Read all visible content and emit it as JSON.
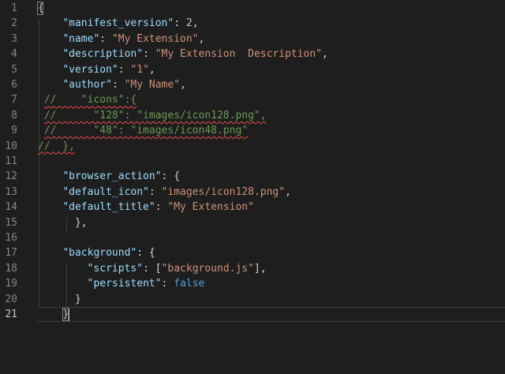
{
  "lines": [
    {
      "n": "1",
      "tokens": [
        {
          "t": "{",
          "c": "punct"
        }
      ]
    },
    {
      "n": "2",
      "tokens": [
        {
          "t": "    ",
          "c": "punct"
        },
        {
          "t": "\"manifest_version\"",
          "c": "key"
        },
        {
          "t": ": ",
          "c": "punct"
        },
        {
          "t": "2",
          "c": "num"
        },
        {
          "t": ",",
          "c": "punct"
        }
      ]
    },
    {
      "n": "3",
      "tokens": [
        {
          "t": "    ",
          "c": "punct"
        },
        {
          "t": "\"name\"",
          "c": "key"
        },
        {
          "t": ": ",
          "c": "punct"
        },
        {
          "t": "\"My Extension\"",
          "c": "str"
        },
        {
          "t": ",",
          "c": "punct"
        }
      ]
    },
    {
      "n": "4",
      "tokens": [
        {
          "t": "    ",
          "c": "punct"
        },
        {
          "t": "\"description\"",
          "c": "key"
        },
        {
          "t": ": ",
          "c": "punct"
        },
        {
          "t": "\"My Extension  Description\"",
          "c": "str"
        },
        {
          "t": ",",
          "c": "punct"
        }
      ]
    },
    {
      "n": "5",
      "tokens": [
        {
          "t": "    ",
          "c": "punct"
        },
        {
          "t": "\"version\"",
          "c": "key"
        },
        {
          "t": ": ",
          "c": "punct"
        },
        {
          "t": "\"1\"",
          "c": "str"
        },
        {
          "t": ",",
          "c": "punct"
        }
      ]
    },
    {
      "n": "6",
      "tokens": [
        {
          "t": "    ",
          "c": "punct"
        },
        {
          "t": "\"author\"",
          "c": "key"
        },
        {
          "t": ": ",
          "c": "punct"
        },
        {
          "t": "\"My Name\"",
          "c": "str"
        },
        {
          "t": ",",
          "c": "punct"
        }
      ]
    },
    {
      "n": "7",
      "tokens": [
        {
          "t": " ",
          "c": "punct"
        },
        {
          "t": "//    \"icons\":{",
          "c": "cmt squig"
        }
      ]
    },
    {
      "n": "8",
      "tokens": [
        {
          "t": " ",
          "c": "punct"
        },
        {
          "t": "//      \"128\": \"images/icon128.png\",",
          "c": "cmt squig"
        }
      ]
    },
    {
      "n": "9",
      "tokens": [
        {
          "t": " ",
          "c": "punct"
        },
        {
          "t": "//      \"48\": \"images/icon48.png\"",
          "c": "cmt squig"
        }
      ]
    },
    {
      "n": "10",
      "tokens": [
        {
          "t": "//  },",
          "c": "cmt squig"
        }
      ]
    },
    {
      "n": "11",
      "tokens": []
    },
    {
      "n": "12",
      "tokens": [
        {
          "t": "    ",
          "c": "punct"
        },
        {
          "t": "\"browser_action\"",
          "c": "key"
        },
        {
          "t": ": {",
          "c": "punct"
        }
      ]
    },
    {
      "n": "13",
      "tokens": [
        {
          "t": "    ",
          "c": "punct"
        },
        {
          "t": "\"default_icon\"",
          "c": "key"
        },
        {
          "t": ": ",
          "c": "punct"
        },
        {
          "t": "\"images/icon128.png\"",
          "c": "str"
        },
        {
          "t": ",",
          "c": "punct"
        }
      ]
    },
    {
      "n": "14",
      "tokens": [
        {
          "t": "    ",
          "c": "punct"
        },
        {
          "t": "\"default_title\"",
          "c": "key"
        },
        {
          "t": ": ",
          "c": "punct"
        },
        {
          "t": "\"My Extension\"",
          "c": "str"
        }
      ]
    },
    {
      "n": "15",
      "tokens": [
        {
          "t": "      },",
          "c": "punct"
        }
      ]
    },
    {
      "n": "16",
      "tokens": []
    },
    {
      "n": "17",
      "tokens": [
        {
          "t": "    ",
          "c": "punct"
        },
        {
          "t": "\"background\"",
          "c": "key"
        },
        {
          "t": ": {",
          "c": "punct"
        }
      ]
    },
    {
      "n": "18",
      "tokens": [
        {
          "t": "        ",
          "c": "punct"
        },
        {
          "t": "\"scripts\"",
          "c": "key"
        },
        {
          "t": ": [",
          "c": "punct"
        },
        {
          "t": "\"background.js\"",
          "c": "str"
        },
        {
          "t": "],",
          "c": "punct"
        }
      ]
    },
    {
      "n": "19",
      "tokens": [
        {
          "t": "        ",
          "c": "punct"
        },
        {
          "t": "\"persistent\"",
          "c": "key"
        },
        {
          "t": ": ",
          "c": "punct"
        },
        {
          "t": "false",
          "c": "kw"
        }
      ]
    },
    {
      "n": "20",
      "tokens": [
        {
          "t": "      }",
          "c": "punct"
        }
      ]
    },
    {
      "n": "21",
      "tokens": [
        {
          "t": "    ",
          "c": "punct"
        },
        {
          "t": "}",
          "c": "punct"
        }
      ]
    }
  ],
  "current_line": "21"
}
